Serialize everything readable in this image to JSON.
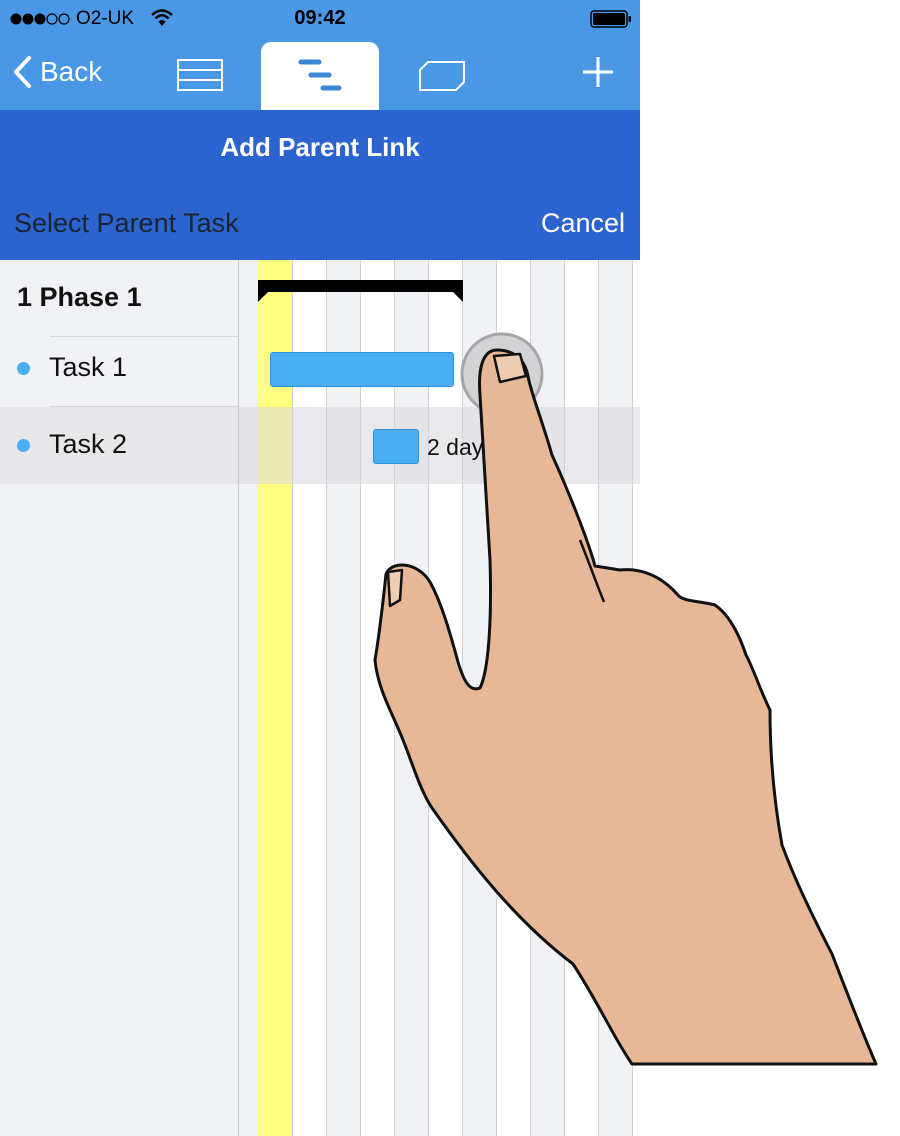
{
  "status_bar": {
    "carrier": "O2-UK",
    "time": "09:42"
  },
  "toolbar": {
    "back_label": "Back",
    "tabs": [
      {
        "name": "list",
        "icon": "list-icon",
        "selected": false
      },
      {
        "name": "gantt",
        "icon": "gantt-icon",
        "selected": true
      },
      {
        "name": "board",
        "icon": "board-icon",
        "selected": false
      }
    ],
    "add_icon": "plus-icon"
  },
  "header": {
    "title": "Add Parent Link",
    "subtitle": "Select Parent Task",
    "cancel_label": "Cancel"
  },
  "tasks": [
    {
      "label": "1 Phase 1",
      "type": "summary"
    },
    {
      "label": "Task 1",
      "type": "task"
    },
    {
      "label": "Task 2",
      "type": "task",
      "selected": true
    }
  ],
  "gantt": {
    "task2_bar_label": "2 day"
  },
  "colors": {
    "toolbar_blue": "#4a97e6",
    "header_blue": "#2c64cf",
    "bar_blue": "#4aaef5",
    "today_yellow": "#ffff80",
    "hand_skin": "#e6b897"
  }
}
